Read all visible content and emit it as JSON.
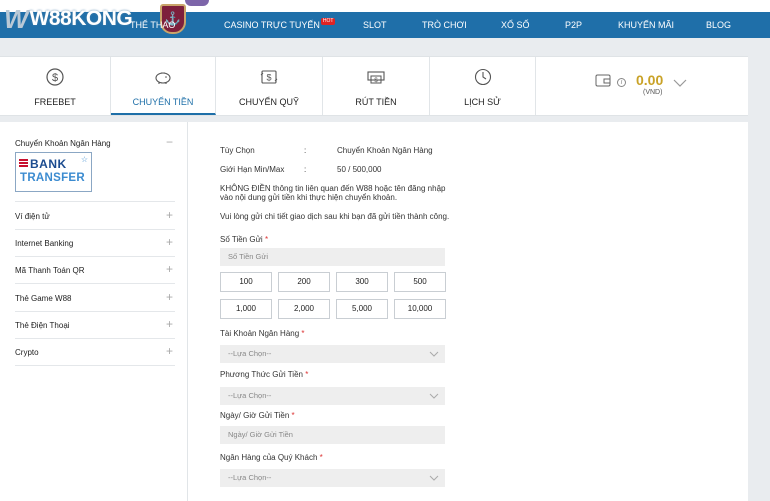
{
  "brand": {
    "logo_mark": "W",
    "name": "W88KONG"
  },
  "topnav": {
    "items": [
      {
        "label": "THỂ THAO"
      },
      {
        "label": "CASINO TRỰC TUYẾN",
        "badge": "HOT"
      },
      {
        "label": "SLOT"
      },
      {
        "label": "TRÒ CHƠI"
      },
      {
        "label": "XỔ SỐ"
      },
      {
        "label": "P2P"
      },
      {
        "label": "KHUYẾN MÃI"
      },
      {
        "label": "BLOG"
      }
    ]
  },
  "tabs": [
    {
      "label": "FREEBET",
      "icon": "dollar-coin-icon"
    },
    {
      "label": "CHUYỂN TIỀN",
      "icon": "piggy-bank-icon",
      "active": true
    },
    {
      "label": "CHUYỂN QUỸ",
      "icon": "transfer-dollar-icon"
    },
    {
      "label": "RÚT TIỀN",
      "icon": "withdraw-cash-icon"
    },
    {
      "label": "LỊCH SỬ",
      "icon": "history-clock-icon"
    }
  ],
  "balance": {
    "amount": "0.00",
    "currency": "(VND)",
    "info_glyph": "i"
  },
  "sidebar": {
    "items": [
      {
        "label": "Chuyển Khoản Ngân Hàng",
        "toggle": "−"
      },
      {
        "label": "Ví điện tử",
        "toggle": "+"
      },
      {
        "label": "Internet Banking",
        "toggle": "+"
      },
      {
        "label": "Mã Thanh Toán QR",
        "toggle": "+"
      },
      {
        "label": "Thẻ Game W88",
        "toggle": "+"
      },
      {
        "label": "Thẻ Điện Thoại",
        "toggle": "+"
      },
      {
        "label": "Crypto",
        "toggle": "+"
      }
    ],
    "bank_logo": {
      "line1": "BANK",
      "line2": "TRANSFER"
    }
  },
  "form": {
    "option_label": "Tùy Chọn",
    "option_sep": ":",
    "option_value": "Chuyển Khoản Ngân Hàng",
    "limit_label": "Giới Hạn Min/Max",
    "limit_sep": ":",
    "limit_value": "50 / 500,000",
    "notice_line1": "KHÔNG ĐIỀN thông tin liên quan đến W88 hoặc tên đăng nhập",
    "notice_line2": "vào nội dung gửi tiền khi thực hiện chuyển khoản.",
    "notice2": "Vui lòng gửi chi tiết giao dịch sau khi bạn đã gửi tiền thành công.",
    "amount_label": "Số Tiền Gửi",
    "amount_placeholder": "Số Tiền Gửi",
    "quick_amounts": [
      "100",
      "200",
      "300",
      "500",
      "1,000",
      "2,000",
      "5,000",
      "10,000"
    ],
    "bank_account_label": "Tài Khoản Ngân Hàng",
    "bank_account_value": "--Lựa Chọn--",
    "method_label": "Phương Thức Gửi Tiền",
    "method_value": "--Lựa Chọn--",
    "datetime_label": "Ngày/ Giờ Gửi Tiền",
    "datetime_placeholder": "Ngày/ Giờ Gửi Tiền",
    "customer_bank_label": "Ngân Hàng của Quý Khách",
    "customer_bank_value": "--Lựa Chọn--",
    "required_mark": "*"
  },
  "colors": {
    "nav": "#1f6fa9",
    "accent": "#1e6fa8",
    "balance": "#c9a227",
    "required": "#dd3333"
  }
}
